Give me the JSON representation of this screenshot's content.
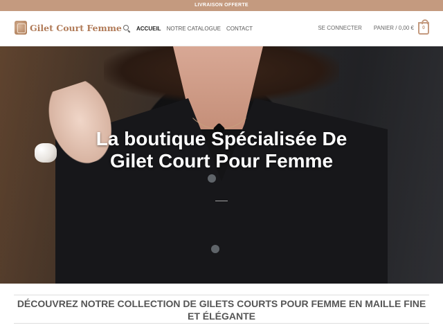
{
  "topbar": {
    "text": "LIVRAISON OFFERTE"
  },
  "header": {
    "logo_text": "Gilet Court Femme",
    "nav": [
      {
        "label": "ACCUEIL",
        "active": true
      },
      {
        "label": "NOTRE CATALOGUE",
        "active": false
      },
      {
        "label": "CONTACT",
        "active": false
      }
    ],
    "login_label": "SE CONNECTER",
    "cart_label": "PANIER / 0,00 €",
    "cart_count": "0"
  },
  "hero": {
    "title": "La boutique Spécialisée De Gilet Court Pour Femme"
  },
  "section": {
    "title": "DÉCOUVREZ NOTRE COLLECTION DE GILETS COURTS POUR FEMME EN MAILLE FINE ET ÉLÉGANTE"
  },
  "colors": {
    "accent": "#c49a7f",
    "logo_text": "#b07a57"
  }
}
